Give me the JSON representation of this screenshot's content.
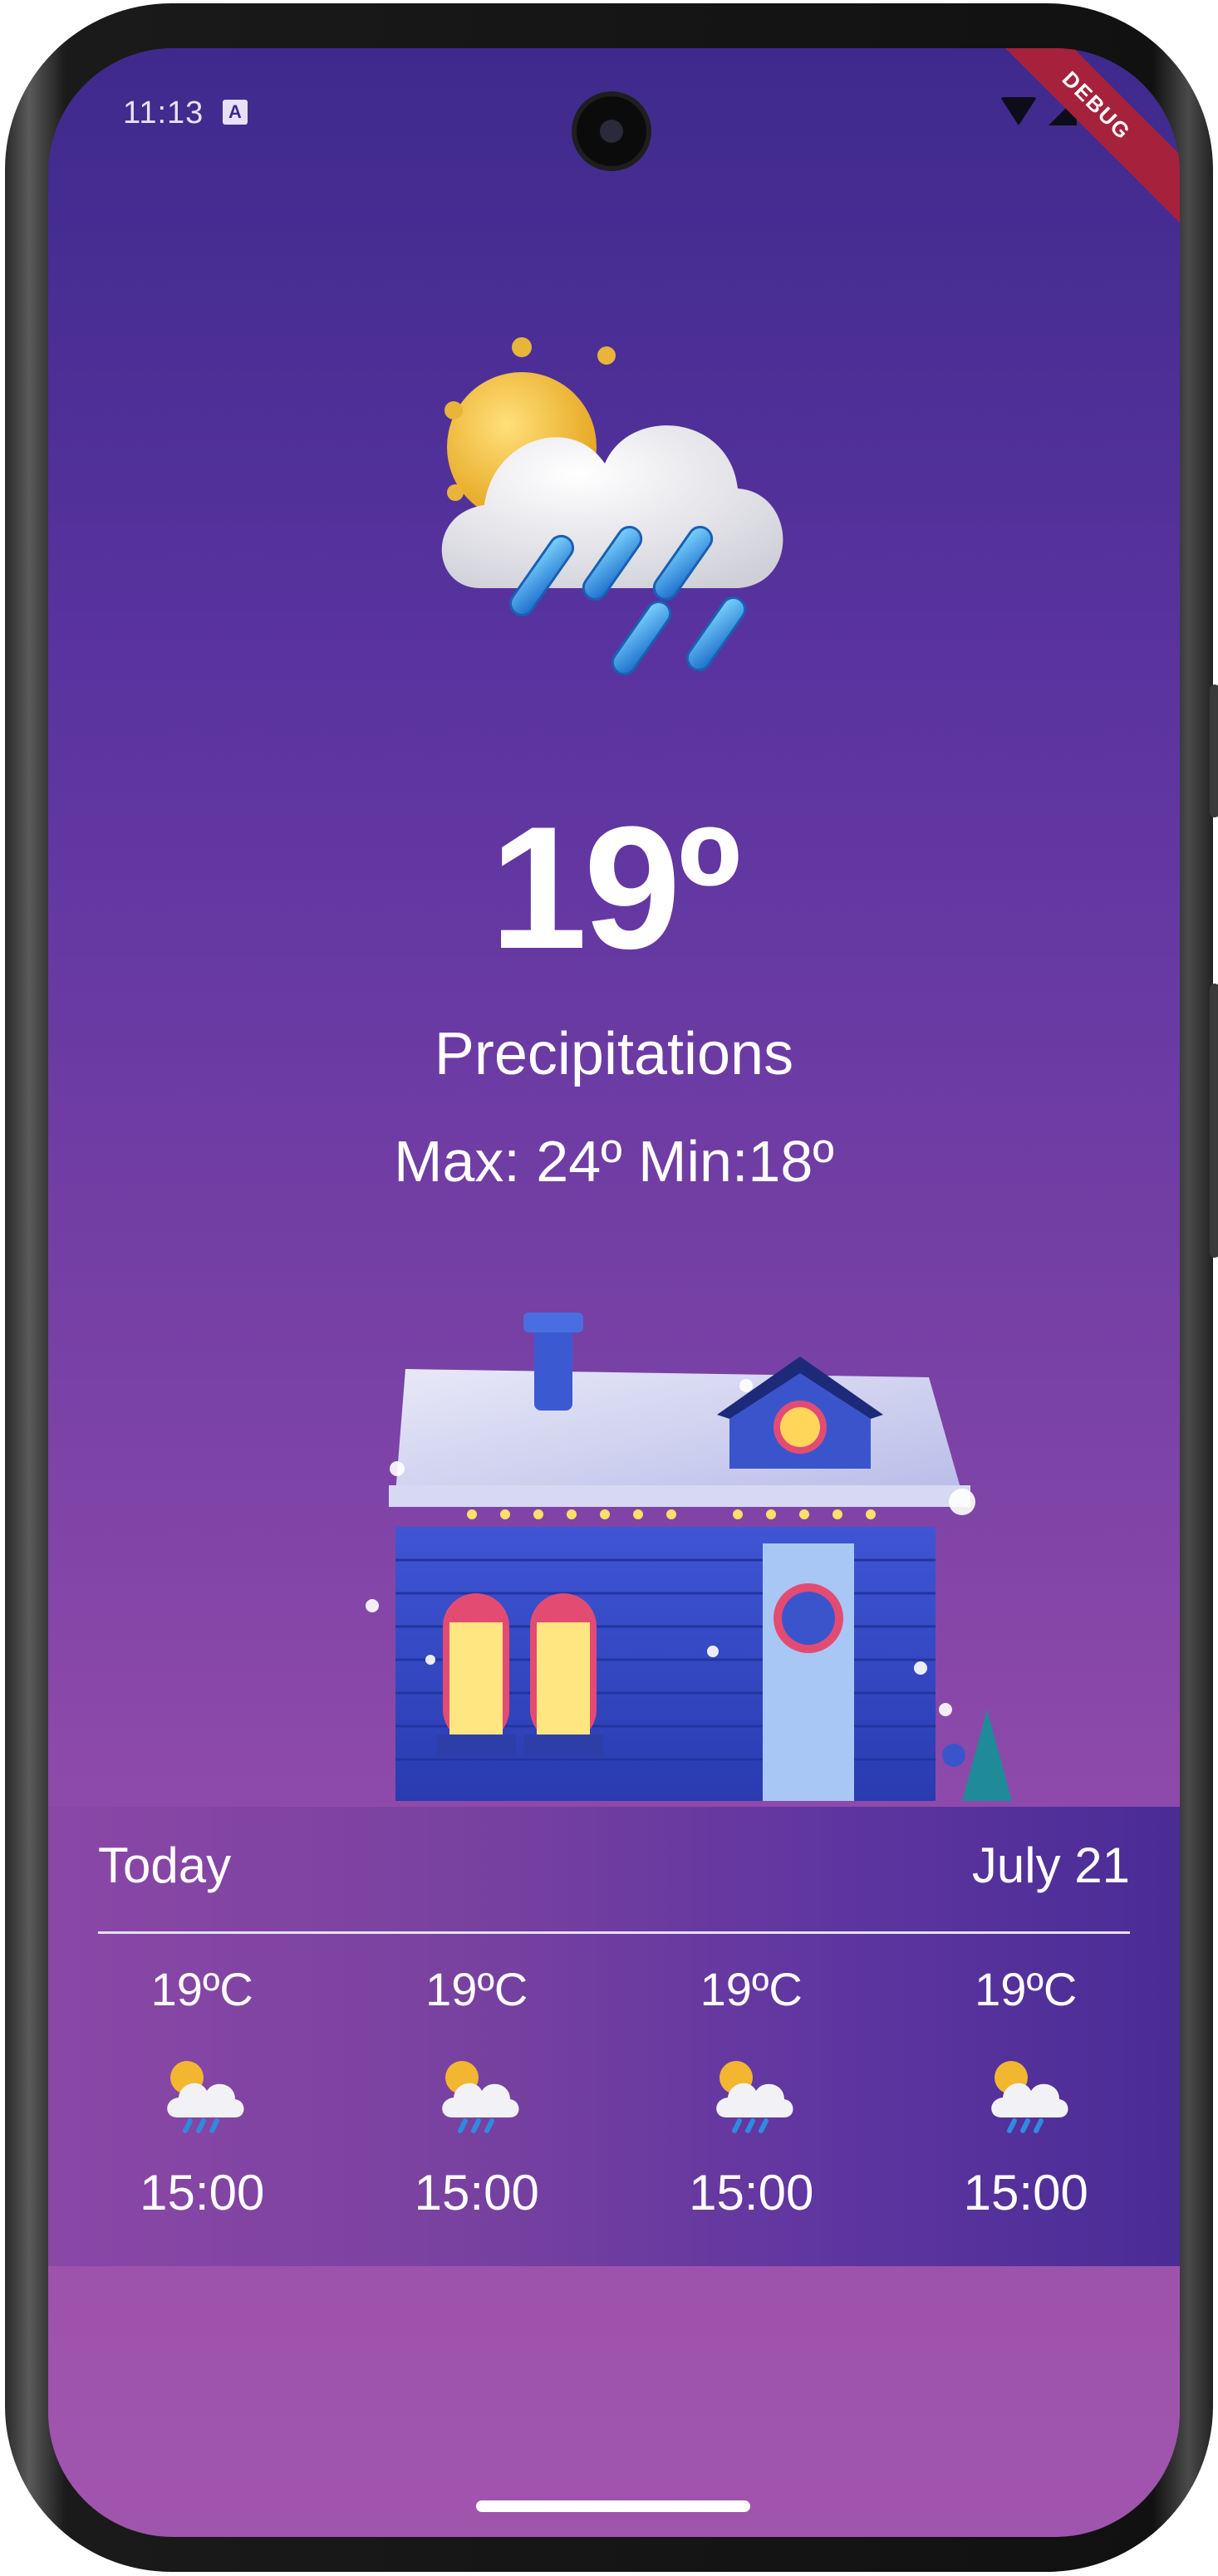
{
  "status_bar": {
    "time": "11:13",
    "notification_icon": "a-icon",
    "debug_banner": "DEBUG"
  },
  "weather": {
    "temperature": "19º",
    "condition": "Precipitations",
    "min_max": "Max: 24º Min:18º",
    "main_icon": "sun-cloud-rain-icon",
    "illustration": "snowy-house-illustration"
  },
  "forecast": {
    "day_label": "Today",
    "date": "July 21",
    "hours": [
      {
        "temp": "19ºC",
        "time": "15:00",
        "icon": "sun-cloud-rain-icon"
      },
      {
        "temp": "19ºC",
        "time": "15:00",
        "icon": "sun-cloud-rain-icon"
      },
      {
        "temp": "19ºC",
        "time": "15:00",
        "icon": "sun-cloud-rain-icon"
      },
      {
        "temp": "19ºC",
        "time": "15:00",
        "icon": "sun-cloud-rain-icon"
      }
    ]
  },
  "colors": {
    "background_top": "#3e2a8c",
    "background_bottom": "#a055ad",
    "text": "#ffffff",
    "debug_banner": "#a5213c"
  }
}
